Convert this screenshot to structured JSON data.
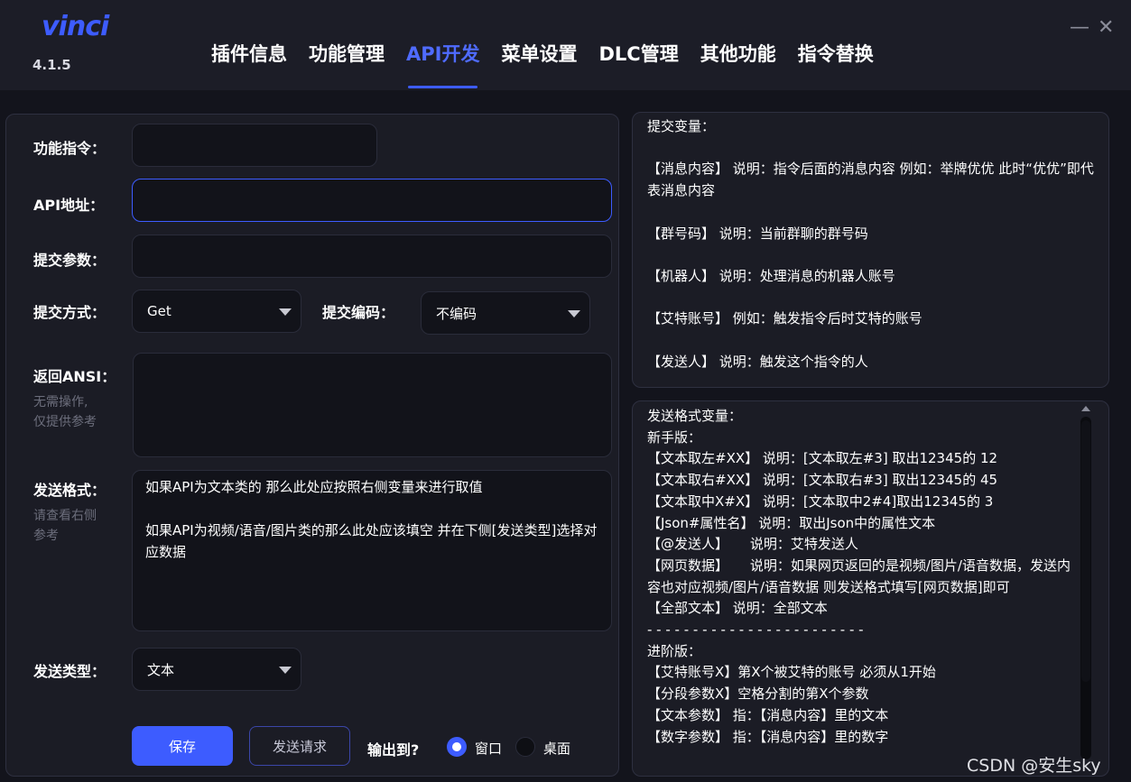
{
  "app": {
    "logo": "vinci",
    "version": "4.1.5",
    "minimize_glyph": "—",
    "close_glyph": "✕"
  },
  "tabs": [
    {
      "label": "插件信息",
      "active": false
    },
    {
      "label": "功能管理",
      "active": false
    },
    {
      "label": "API开发",
      "active": true
    },
    {
      "label": "菜单设置",
      "active": false
    },
    {
      "label": "DLC管理",
      "active": false
    },
    {
      "label": "其他功能",
      "active": false
    },
    {
      "label": "指令替换",
      "active": false
    }
  ],
  "form": {
    "command_label": "功能指令：",
    "command_value": "",
    "api_label": "API地址：",
    "api_value": "",
    "params_label": "提交参数：",
    "params_value": "",
    "method_label": "提交方式：",
    "method_value": "Get",
    "encoding_label": "提交编码：",
    "encoding_value": "不编码",
    "ansi_label": "返回ANSI：",
    "ansi_hint": "无需操作,\n仅提供参考",
    "ansi_value": "",
    "format_label": "发送格式：",
    "format_hint": "请查看右侧\n参考",
    "format_value": "如果API为文本类的 那么此处应按照右侧变量来进行取值\n\n如果API为视频/语音/图片类的那么此处应该填空 并在下侧[发送类型]选择对应数据",
    "type_label": "发送类型：",
    "type_value": "文本",
    "save_button": "保存",
    "send_button": "发送请求",
    "output_label": "输出到?",
    "output_window": "窗口",
    "output_desktop": "桌面"
  },
  "submit_vars": "提交变量：\n\n【消息内容】 说明：指令后面的消息内容 例如：举牌优优 此时“优优”即代表消息内容\n\n【群号码】 说明：当前群聊的群号码\n\n【机器人】 说明：处理消息的机器人账号\n\n【艾特账号】 例如：触发指令后时艾特的账号\n\n【发送人】 说明：触发这个指令的人",
  "format_vars": "发送格式变量：\n新手版：\n【文本取左#XX】 说明：[文本取左#3] 取出12345的 12\n【文本取右#XX】 说明：[文本取右#3] 取出12345的 45\n【文本取中X#X】 说明：[文本取中2#4]取出12345的 3\n【Json#属性名】 说明：取出Json中的属性文本\n【@发送人】     说明：艾特发送人\n【网页数据】     说明：如果网页返回的是视频/图片/语音数据，发送内容也对应视频/图片/语音数据 则发送格式填写[网页数据]即可\n【全部文本】 说明：全部文本\n- - - - - - - - - - - - - - - - - - - - - - - -\n进阶版：\n【艾特账号X】第X个被艾特的账号 必须从1开始\n【分段参数X】空格分割的第X个参数\n【文本参数】 指：【消息内容】里的文本\n【数字参数】 指：【消息内容】里的数字",
  "watermark": "CSDN @安生sky"
}
